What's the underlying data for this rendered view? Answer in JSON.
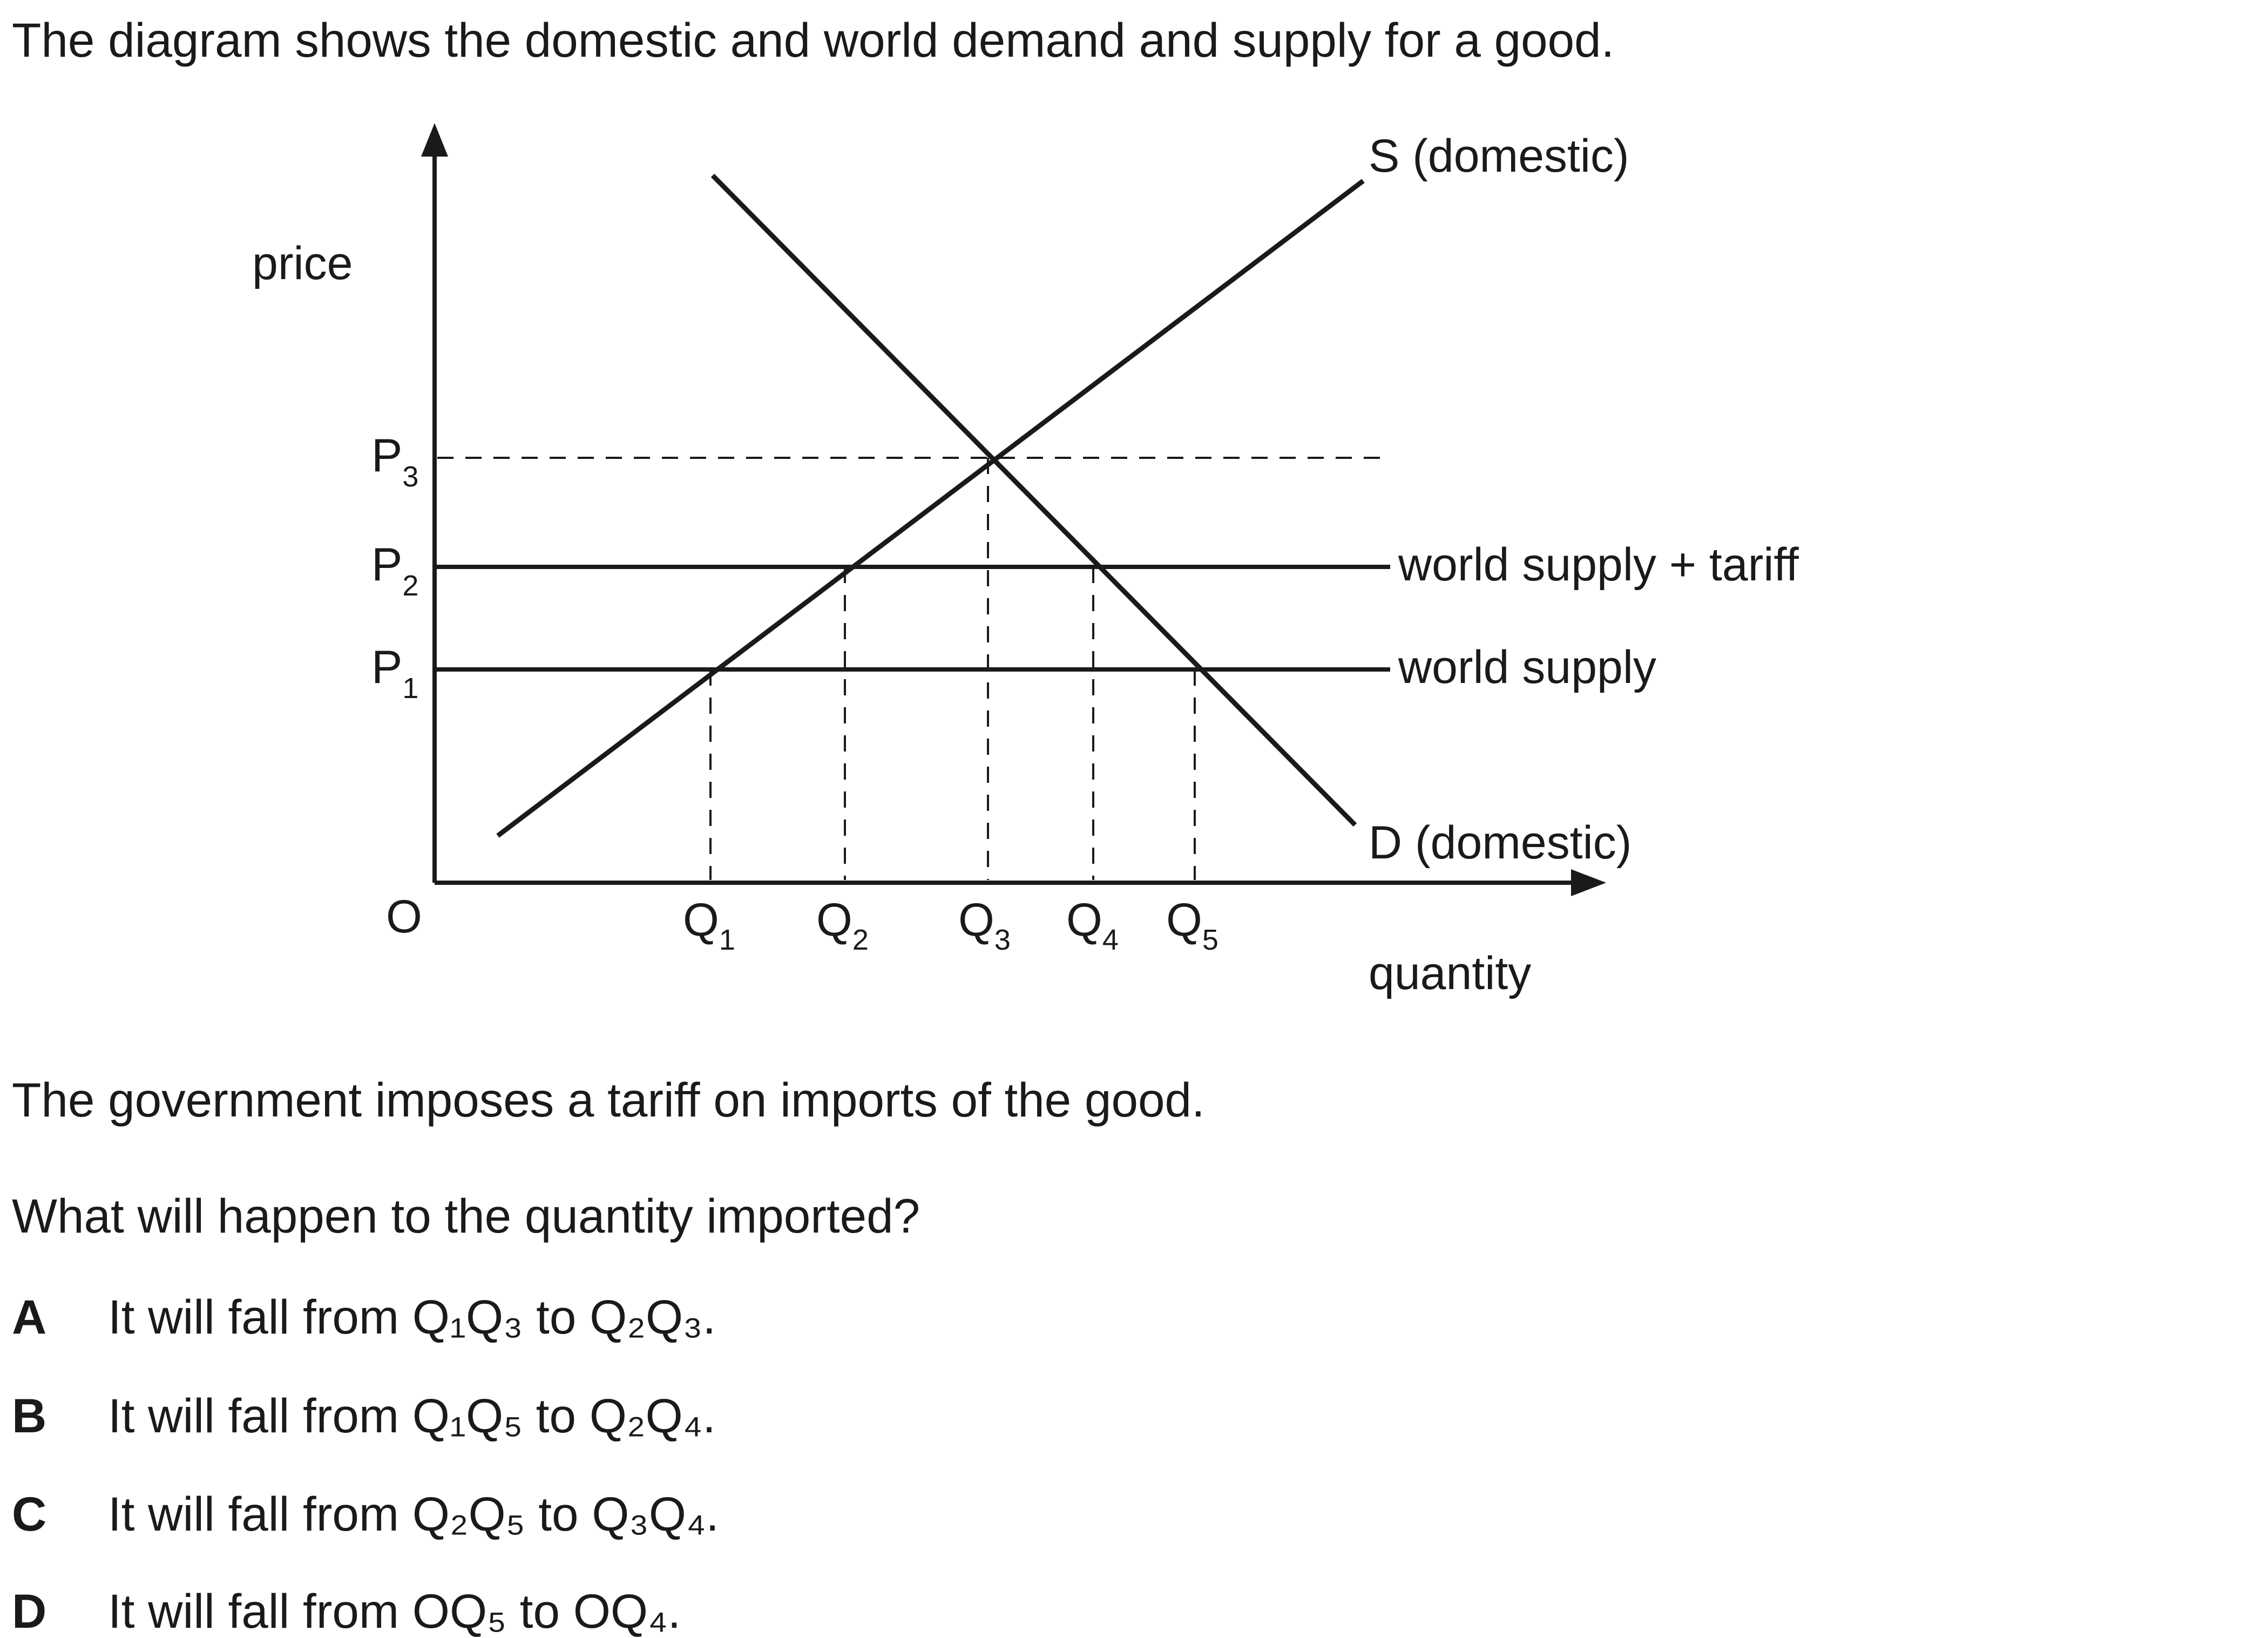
{
  "intro": "The diagram shows the domestic and world demand and supply for a good.",
  "diagram": {
    "y_axis_label": "price",
    "x_axis_label": "quantity",
    "origin_label": "O",
    "price_levels": [
      {
        "symbol": "P",
        "sub": "3"
      },
      {
        "symbol": "P",
        "sub": "2"
      },
      {
        "symbol": "P",
        "sub": "1"
      }
    ],
    "quantities": [
      {
        "symbol": "Q",
        "sub": "1"
      },
      {
        "symbol": "Q",
        "sub": "2"
      },
      {
        "symbol": "Q",
        "sub": "3"
      },
      {
        "symbol": "Q",
        "sub": "4"
      },
      {
        "symbol": "Q",
        "sub": "5"
      }
    ],
    "line_labels": {
      "supply": "S (domestic)",
      "demand": "D (domestic)",
      "world_tariff": "world supply + tariff",
      "world": "world supply"
    }
  },
  "stem": "The government imposes a tariff on imports of the good.",
  "question": "What will happen to the quantity imported?",
  "options": [
    {
      "letter": "A",
      "text": "It will fall from Q₁Q₃ to Q₂Q₃."
    },
    {
      "letter": "B",
      "text": "It will fall from Q₁Q₅ to Q₂Q₄."
    },
    {
      "letter": "C",
      "text": "It will fall from Q₂Q₅ to Q₃Q₄."
    },
    {
      "letter": "D",
      "text": "It will fall from OQ₅ to OQ₄."
    }
  ]
}
